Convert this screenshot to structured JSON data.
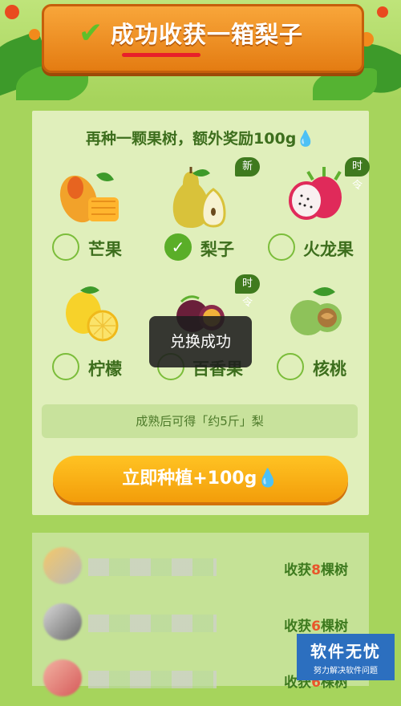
{
  "header": {
    "title": "成功收获一箱梨子",
    "check_glyph": "✔"
  },
  "panel": {
    "title": "再种一颗果树，额外奖励100g",
    "drop_glyph": "💧"
  },
  "fruits": [
    {
      "label": "芒果",
      "checked": false,
      "badge": ""
    },
    {
      "label": "梨子",
      "checked": true,
      "badge": "新"
    },
    {
      "label": "火龙果",
      "checked": false,
      "badge": "时令"
    },
    {
      "label": "柠檬",
      "checked": false,
      "badge": ""
    },
    {
      "label": "百香果",
      "checked": false,
      "badge": "时令"
    },
    {
      "label": "核桃",
      "checked": false,
      "badge": ""
    }
  ],
  "info_bar": "成熟后可得「约5斤」梨",
  "plant_button": {
    "label": "立即种植+100g",
    "drop_glyph": "💧"
  },
  "toast": "兑换成功",
  "harvest_list": [
    {
      "prefix": "收获",
      "count": "8",
      "suffix": "棵树"
    },
    {
      "prefix": "收获",
      "count": "6",
      "suffix": "棵树"
    },
    {
      "prefix": "收获",
      "count": "6",
      "suffix": "棵树"
    }
  ],
  "watermark": {
    "main": "软件无忧",
    "sub": "努力解决软件问题"
  },
  "colors": {
    "background": "#a6d45c",
    "panel": "#e0efbb",
    "accent_green": "#5aae28",
    "button_orange": "#f39d0a",
    "sign_orange": "#e47c12"
  }
}
